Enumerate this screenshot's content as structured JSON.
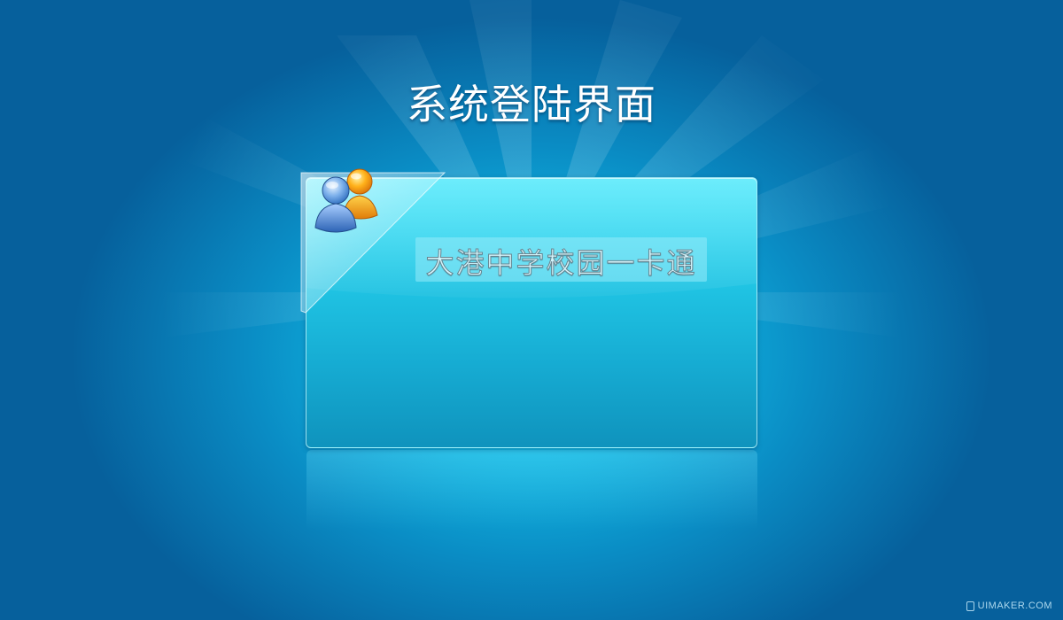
{
  "page": {
    "title": "系统登陆界面"
  },
  "panel": {
    "app_name": "大港中学校园一卡通",
    "icon": "users-icon"
  },
  "watermark": {
    "text": "UIMAKER.COM"
  },
  "colors": {
    "background_center": "#1fd2f2",
    "background_edge": "#06609c",
    "panel_top": "#34e6fb",
    "panel_bottom": "#0f93bd",
    "title_text": "#ffffff"
  }
}
